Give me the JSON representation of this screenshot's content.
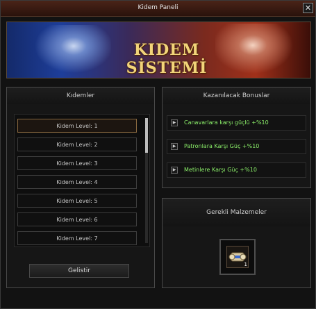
{
  "window": {
    "title": "Kidem Paneli"
  },
  "banner": {
    "title": "KIDEM SİSTEMİ"
  },
  "levels": {
    "header": "Kıdemler",
    "items": [
      {
        "label": "Kidem Level: 1"
      },
      {
        "label": "Kidem Level: 2"
      },
      {
        "label": "Kidem Level: 3"
      },
      {
        "label": "Kidem Level: 4"
      },
      {
        "label": "Kidem Level: 5"
      },
      {
        "label": "Kidem Level: 6"
      },
      {
        "label": "Kidem Level: 7"
      }
    ],
    "selected_index": 0,
    "upgrade_label": "Gelistir"
  },
  "bonuses": {
    "header": "Kazanılacak Bonuslar",
    "items": [
      {
        "label": "Canavarlara karşı güçlü +%10"
      },
      {
        "label": "Patronlara Karşı Güç +%10"
      },
      {
        "label": "Metinlere Karşı Güç +%10"
      }
    ],
    "text_color": "#8cf06a"
  },
  "materials": {
    "header": "Gerekli Malzemeler",
    "items": [
      {
        "icon": "scroll-icon",
        "count": "1"
      }
    ]
  },
  "colors": {
    "title_bar": "#3a1a12",
    "banner_text": "#f2d47a",
    "selected_border": "#8a6a40"
  }
}
